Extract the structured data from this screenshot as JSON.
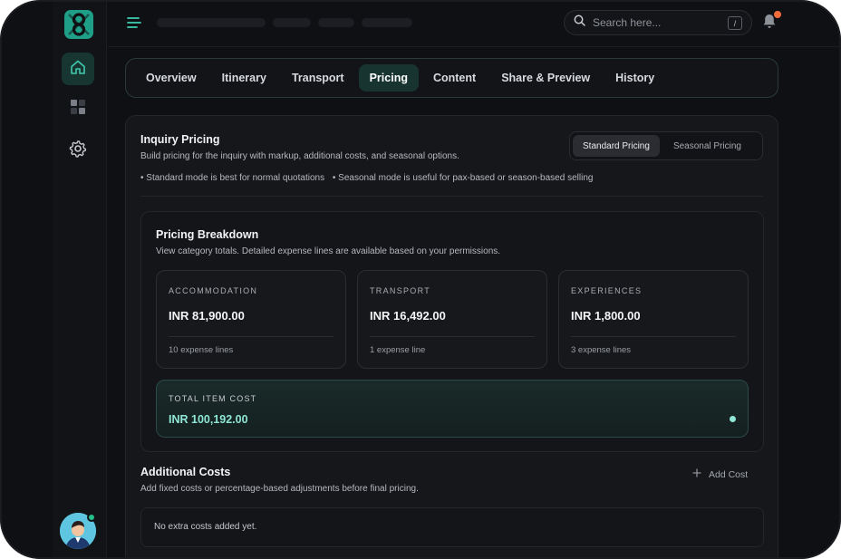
{
  "app": {
    "search_placeholder": "Search here...",
    "search_shortcut": "/"
  },
  "tabs": [
    {
      "label": "Overview"
    },
    {
      "label": "Itinerary"
    },
    {
      "label": "Transport"
    },
    {
      "label": "Pricing",
      "active": true
    },
    {
      "label": "Content"
    },
    {
      "label": "Share & Preview"
    },
    {
      "label": "History"
    }
  ],
  "pricing": {
    "title": "Inquiry Pricing",
    "subtitle": "Build pricing for the inquiry with markup, additional costs, and seasonal options.",
    "note_standard": "Standard mode is best for normal quotations",
    "note_seasonal": "Seasonal mode is useful for pax-based or season-based selling",
    "mode_standard": "Standard Pricing",
    "mode_seasonal": "Seasonal Pricing",
    "selected_mode": "Standard Pricing"
  },
  "breakdown": {
    "title": "Pricing Breakdown",
    "subtitle": "View category totals. Detailed expense lines are available based on your permissions.",
    "categories": [
      {
        "label": "ACCOMMODATION",
        "value": "INR 81,900.00",
        "lines": "10 expense lines"
      },
      {
        "label": "TRANSPORT",
        "value": "INR 16,492.00",
        "lines": "1 expense line"
      },
      {
        "label": "EXPERIENCES",
        "value": "INR 1,800.00",
        "lines": "3 expense lines"
      }
    ],
    "total_label": "TOTAL ITEM COST",
    "total_value": "INR 100,192.00"
  },
  "additional": {
    "title": "Additional Costs",
    "subtitle": "Add fixed costs or percentage-based adjustments before final pricing.",
    "add_label": "Add Cost",
    "empty_text": "No extra costs added yet."
  },
  "colors": {
    "accent": "#1fa58a",
    "accent_text": "#8fe6d6",
    "notification": "#f26b3a",
    "online": "#24c08c"
  }
}
